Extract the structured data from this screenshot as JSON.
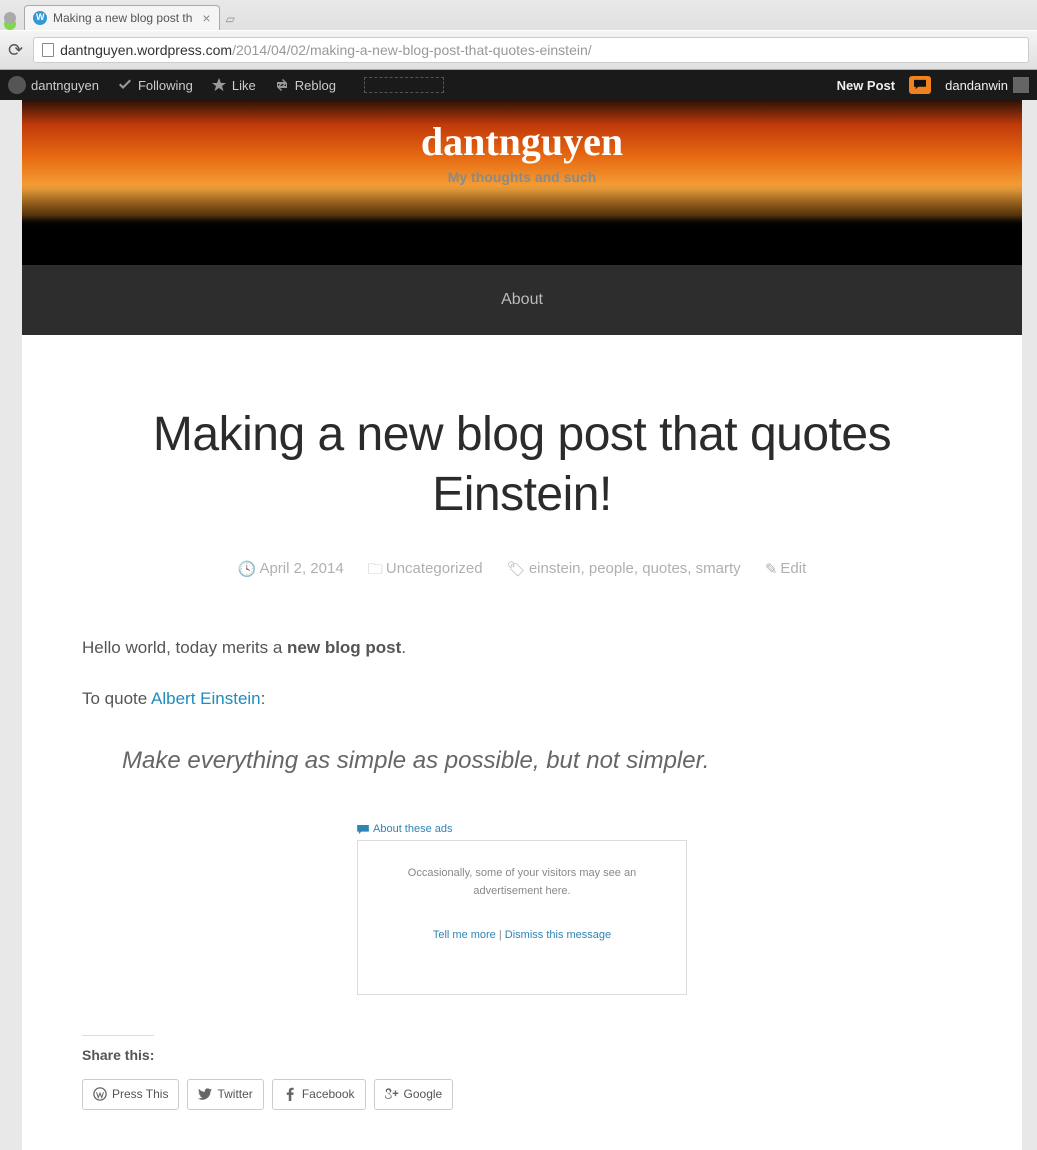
{
  "browser": {
    "tab_title": "Making a new blog post th",
    "url_domain": "dantnguyen.wordpress.com",
    "url_path": "/2014/04/02/making-a-new-blog-post-that-quotes-einstein/"
  },
  "wpbar": {
    "site_name": "dantnguyen",
    "following": "Following",
    "like": "Like",
    "reblog": "Reblog",
    "new_post": "New Post",
    "username": "dandanwin"
  },
  "site": {
    "title": "dantnguyen",
    "tagline": "My thoughts and such",
    "nav_about": "About"
  },
  "post": {
    "title": "Making a new blog post that quotes Einstein!",
    "date": "April 2, 2014",
    "category": "Uncategorized",
    "tags": {
      "t1": "einstein",
      "t2": "people",
      "t3": "quotes",
      "t4": "smarty"
    },
    "edit": "Edit",
    "body": {
      "p1_pre": "Hello world, today merits a ",
      "p1_strong": "new blog post",
      "p1_post": ".",
      "p2_pre": "To quote ",
      "p2_link": "Albert Einstein",
      "p2_post": ":",
      "quote": "Make everything as simple as possible, but not simpler."
    }
  },
  "ads": {
    "about": "About these ads",
    "notice": "Occasionally, some of your visitors may see an advertisement here.",
    "tell_more": "Tell me more",
    "divider": " | ",
    "dismiss": "Dismiss this message"
  },
  "share": {
    "heading": "Share this:",
    "press": "Press This",
    "twitter": "Twitter",
    "facebook": "Facebook",
    "google": "Google"
  }
}
